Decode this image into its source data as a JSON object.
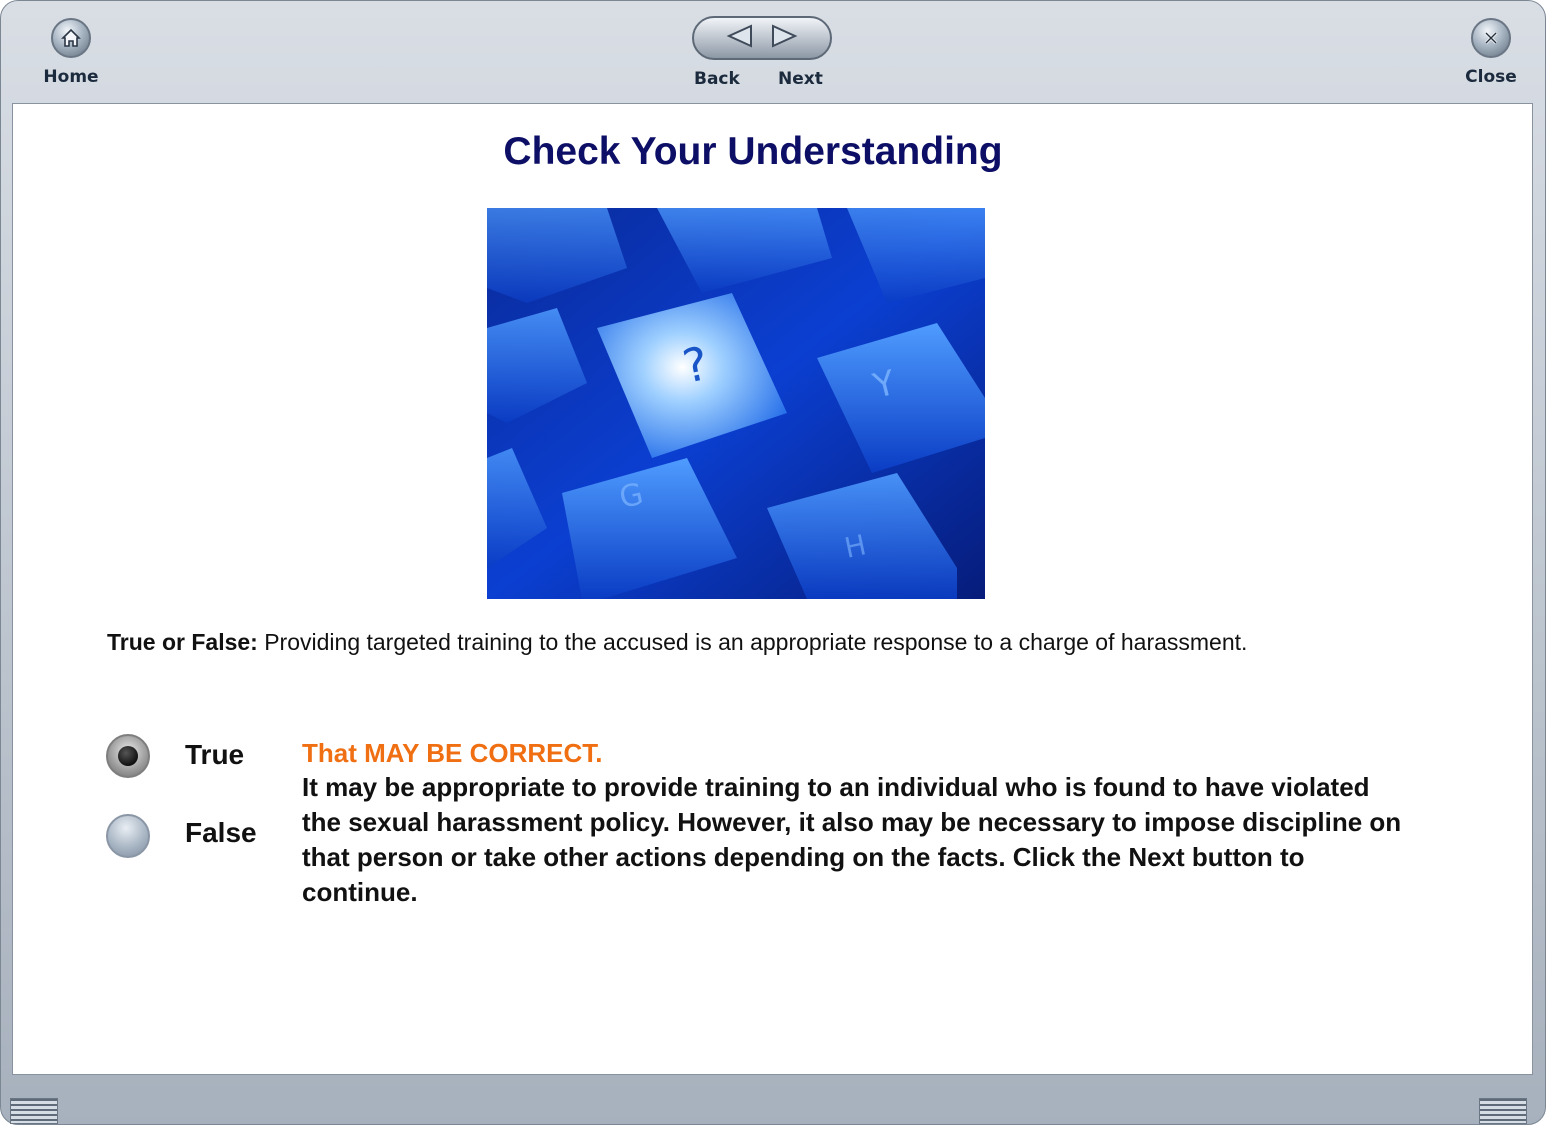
{
  "toolbar": {
    "home_label": "Home",
    "back_label": "Back",
    "next_label": "Next",
    "close_label": "Close"
  },
  "main": {
    "title": "Check Your Understanding",
    "image_icon": "keyboard-question-mark-key",
    "question_prefix": "True or False:",
    "question_text": " Providing targeted training to the accused is an appropriate response to a charge of harassment.",
    "options": [
      {
        "label": "True",
        "selected": true
      },
      {
        "label": "False",
        "selected": false
      }
    ],
    "feedback_title": "That MAY BE CORRECT.",
    "feedback_body": "It may be appropriate to provide training to an individual who is found to have violated the sexual harassment policy. However, it also may be necessary to impose discipline on that person or take other actions depending on the facts. Click the Next button to continue."
  },
  "colors": {
    "title": "#0d0f66",
    "feedback_title": "#f06f12",
    "frame": "#a7b1bd"
  }
}
